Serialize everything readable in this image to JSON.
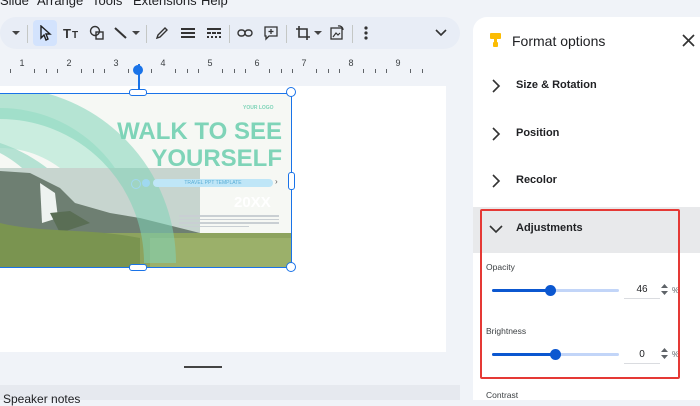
{
  "menubar": {
    "items": [
      "Slide",
      "Arrange",
      "Tools",
      "Extensions",
      "Help"
    ]
  },
  "toolbar": {
    "icons": [
      "dropdown-arrow-icon",
      "select-pointer-icon",
      "text-box-icon",
      "shape-icon",
      "line-icon",
      "pen-icon",
      "align-icon",
      "line-style-icon",
      "link-icon",
      "comment-icon",
      "crop-icon",
      "replace-image-icon",
      "more-icon",
      "collapse-icon"
    ]
  },
  "ruler": {
    "numbers": [
      "1",
      "2",
      "3",
      "4",
      "5",
      "6",
      "7",
      "8",
      "9"
    ]
  },
  "slide": {
    "logo": "YOUR LOGO",
    "headline1": "WALK TO SEE",
    "headline2": "YOURSELF",
    "subtitle": "TRAVEL PPT TEMPLATE",
    "year": "20XX"
  },
  "panel": {
    "title": "Format options",
    "sections": {
      "size_rotation": "Size & Rotation",
      "position": "Position",
      "recolor": "Recolor",
      "adjustments": "Adjustments",
      "contrast": "Contrast"
    },
    "opacity": {
      "label": "Opacity",
      "value": "46",
      "unit": "%",
      "level_percent": 46
    },
    "brightness": {
      "label": "Brightness",
      "value": "0",
      "unit": "%",
      "level_percent": 50
    }
  },
  "notes": {
    "label": "Speaker notes"
  },
  "colors": {
    "accent": "#0b57d0",
    "selection": "#1a73e8",
    "highlight": "#e53935",
    "teal": "#7fd4b8"
  }
}
